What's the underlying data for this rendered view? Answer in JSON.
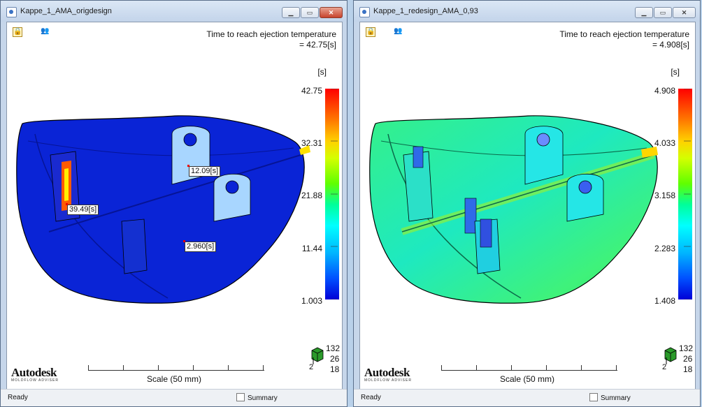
{
  "windows": {
    "left": {
      "title": "Kappe_1_AMA_origdesign",
      "result_title": "Time to reach ejection temperature",
      "result_value": "= 42.75[s]",
      "unit": "[s]",
      "legend": [
        "42.75",
        "32.31",
        "21.88",
        "11.44",
        "1.003"
      ],
      "probes": [
        "39.49[s]",
        "12.09[s]",
        "2.960[s]"
      ],
      "scale_label": "Scale (50 mm)",
      "triad": [
        "132",
        "26",
        "18",
        "2"
      ],
      "status": "Ready",
      "summary_label": "Summary",
      "brand": "Autodesk",
      "brand_sub": "MOLDFLOW ADVISER",
      "part_color": "#0a24d6",
      "legend_max": 42.75,
      "legend_min": 1.003
    },
    "right": {
      "title": "Kappe_1_redesign_AMA_0,93",
      "result_title": "Time to reach ejection temperature",
      "result_value": "= 4.908[s]",
      "unit": "[s]",
      "legend": [
        "4.908",
        "4.033",
        "3.158",
        "2.283",
        "1.408"
      ],
      "scale_label": "Scale (50 mm)",
      "triad": [
        "132",
        "26",
        "18",
        "2"
      ],
      "status": "Ready",
      "summary_label": "Summary",
      "brand": "Autodesk",
      "brand_sub": "MOLDFLOW ADVISER",
      "part_color": "#18e6a0",
      "legend_max": 4.908,
      "legend_min": 1.408
    }
  },
  "icons": [
    "lock-icon",
    "people-icon",
    "close-icon",
    "maximize-icon",
    "minimize-icon",
    "view-triad-icon"
  ]
}
